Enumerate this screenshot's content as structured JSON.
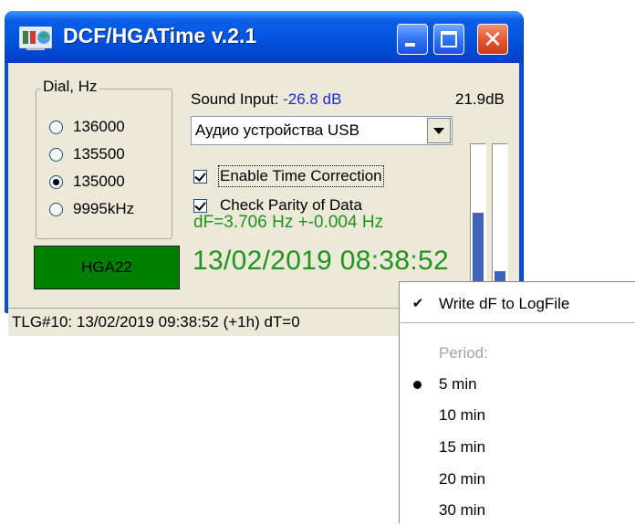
{
  "window": {
    "title": "DCF/HGATime v.2.1",
    "close_glyph": "✕"
  },
  "dial": {
    "label": "Dial, Hz",
    "options": [
      {
        "label": "136000",
        "selected": false
      },
      {
        "label": "135500",
        "selected": false
      },
      {
        "label": "135000",
        "selected": true
      },
      {
        "label": "9995kHz",
        "selected": false
      }
    ]
  },
  "station": {
    "label": "HGA22",
    "color": "#008000"
  },
  "sound": {
    "label": "Sound Input: ",
    "value": "-26.8 dB",
    "peak": "21.9dB",
    "device": "Аудио устройства USB",
    "meter_levels": [
      0.53,
      0.13
    ]
  },
  "options": {
    "enable_time_correction": "Enable Time Correction",
    "check_parity": "Check Parity of Data"
  },
  "readout": {
    "df": "dF=3.706 Hz +-0.004 Hz",
    "datetime": "13/02/2019 08:38:52"
  },
  "status": {
    "text": "TLG#10: 13/02/2019 09:38:52 (+1h) dT=0"
  },
  "menu": {
    "write_df": "Write dF to LogFile",
    "check_glyph": "✔",
    "period_label": "Period:",
    "periods": [
      "5 min",
      "10 min",
      "15 min",
      "20 min",
      "30 min"
    ],
    "selected_period": "5 min"
  },
  "colors": {
    "title_bar": "#0456e0",
    "readout_green": "#1e941e",
    "sound_value_blue": "#1d2ad3",
    "meter_blue": "#3e63b7"
  }
}
